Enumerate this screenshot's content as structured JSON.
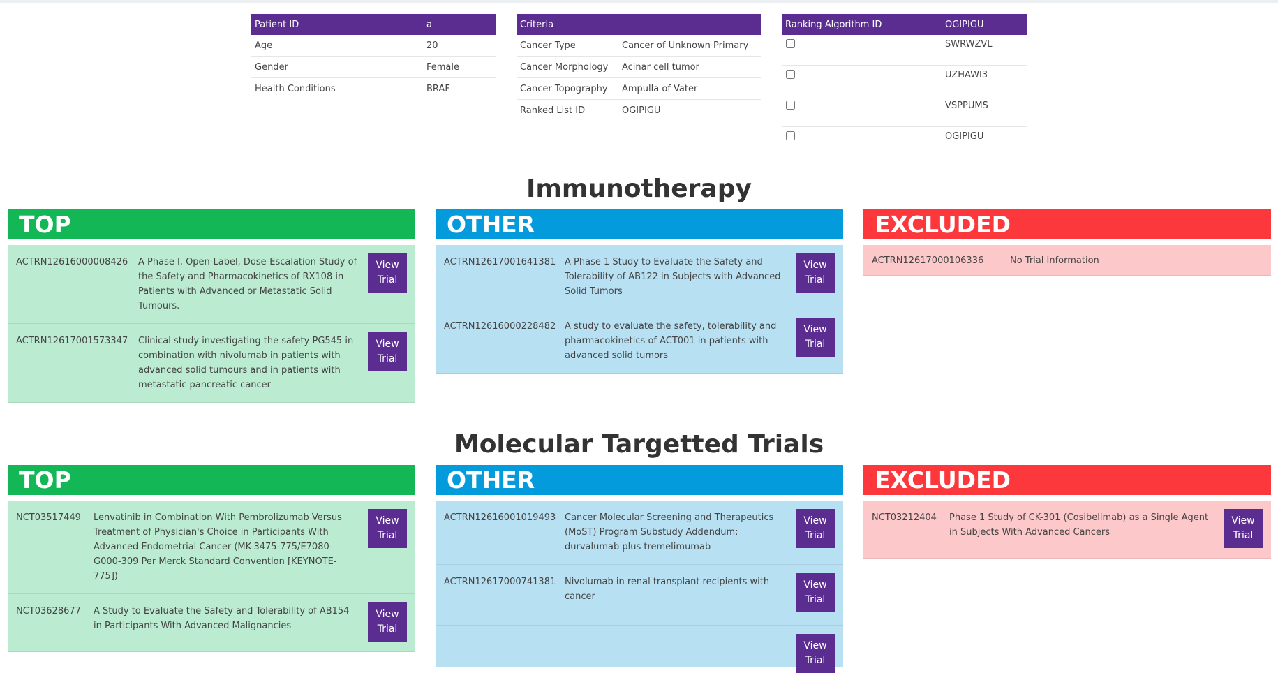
{
  "patient": {
    "header": [
      "Patient ID",
      "a"
    ],
    "rows": [
      {
        "label": "Age",
        "value": "20"
      },
      {
        "label": "Gender",
        "value": "Female"
      },
      {
        "label": "Health Conditions",
        "value": "BRAF"
      }
    ]
  },
  "criteria": {
    "header": [
      "Criteria",
      ""
    ],
    "rows": [
      {
        "label": "Cancer Type",
        "value": "Cancer of Unknown Primary"
      },
      {
        "label": "Cancer Morphology",
        "value": "Acinar cell tumor"
      },
      {
        "label": "Cancer Topography",
        "value": "Ampulla of Vater"
      },
      {
        "label": "Ranked List ID",
        "value": "OGIPIGU"
      }
    ]
  },
  "ranking": {
    "header": [
      "Ranking Algorithm ID",
      "OGIPIGU"
    ],
    "rows": [
      {
        "value": "SWRWZVL",
        "checked": false
      },
      {
        "value": "UZHAWI3",
        "checked": false
      },
      {
        "value": "VSPPUMS",
        "checked": false
      },
      {
        "value": "OGIPIGU",
        "checked": false
      }
    ]
  },
  "button_label": "View\nTrial",
  "sections": [
    {
      "title": "Immunotherapy",
      "columns": {
        "top": {
          "label": "TOP",
          "trials": [
            {
              "id": "ACTRN12616000008426",
              "title": "A Phase I, Open-Label, Dose-Escalation Study of the Safety and Pharmacokinetics of RX108 in Patients with Advanced or Metastatic Solid Tumours."
            },
            {
              "id": "ACTRN12617001573347",
              "title": "Clinical study investigating the safety PG545 in combination with nivolumab in patients with advanced solid tumours and in patients with metastatic pancreatic cancer"
            }
          ]
        },
        "other": {
          "label": "OTHER",
          "trials": [
            {
              "id": "ACTRN12617001641381",
              "title": "A Phase 1 Study to Evaluate the Safety and Tolerability of AB122 in Subjects with Advanced Solid Tumors"
            },
            {
              "id": "ACTRN12616000228482",
              "title": "A study to evaluate the safety, tolerability and pharmacokinetics of ACT001 in patients with advanced solid tumors"
            }
          ]
        },
        "excluded": {
          "label": "EXCLUDED",
          "trials": [
            {
              "id": "ACTRN12617000106336",
              "title": "No Trial Information",
              "no_button": true
            }
          ]
        }
      }
    },
    {
      "title": "Molecular Targetted Trials",
      "columns": {
        "top": {
          "label": "TOP",
          "trials": [
            {
              "id": "NCT03517449",
              "title": "Lenvatinib in Combination With Pembrolizumab Versus Treatment of Physician's Choice in Participants With Advanced Endometrial Cancer (MK-3475-775/E7080-G000-309 Per Merck Standard Convention [KEYNOTE-775])"
            },
            {
              "id": "NCT03628677",
              "title": "A Study to Evaluate the Safety and Tolerability of AB154 in Participants With Advanced Malignancies"
            }
          ]
        },
        "other": {
          "label": "OTHER",
          "trials": [
            {
              "id": "ACTRN12616001019493",
              "title": "Cancer Molecular Screening and Therapeutics (MoST) Program Substudy Addendum: durvalumab plus tremelimumab"
            },
            {
              "id": "ACTRN12617000741381",
              "title": "Nivolumab in renal transplant recipients with cancer"
            },
            {
              "id": "",
              "title": ""
            }
          ]
        },
        "excluded": {
          "label": "EXCLUDED",
          "trials": [
            {
              "id": "NCT03212404",
              "title": "Phase 1 Study of CK-301 (Cosibelimab) as a Single Agent in Subjects With Advanced Cancers"
            }
          ]
        }
      }
    }
  ]
}
